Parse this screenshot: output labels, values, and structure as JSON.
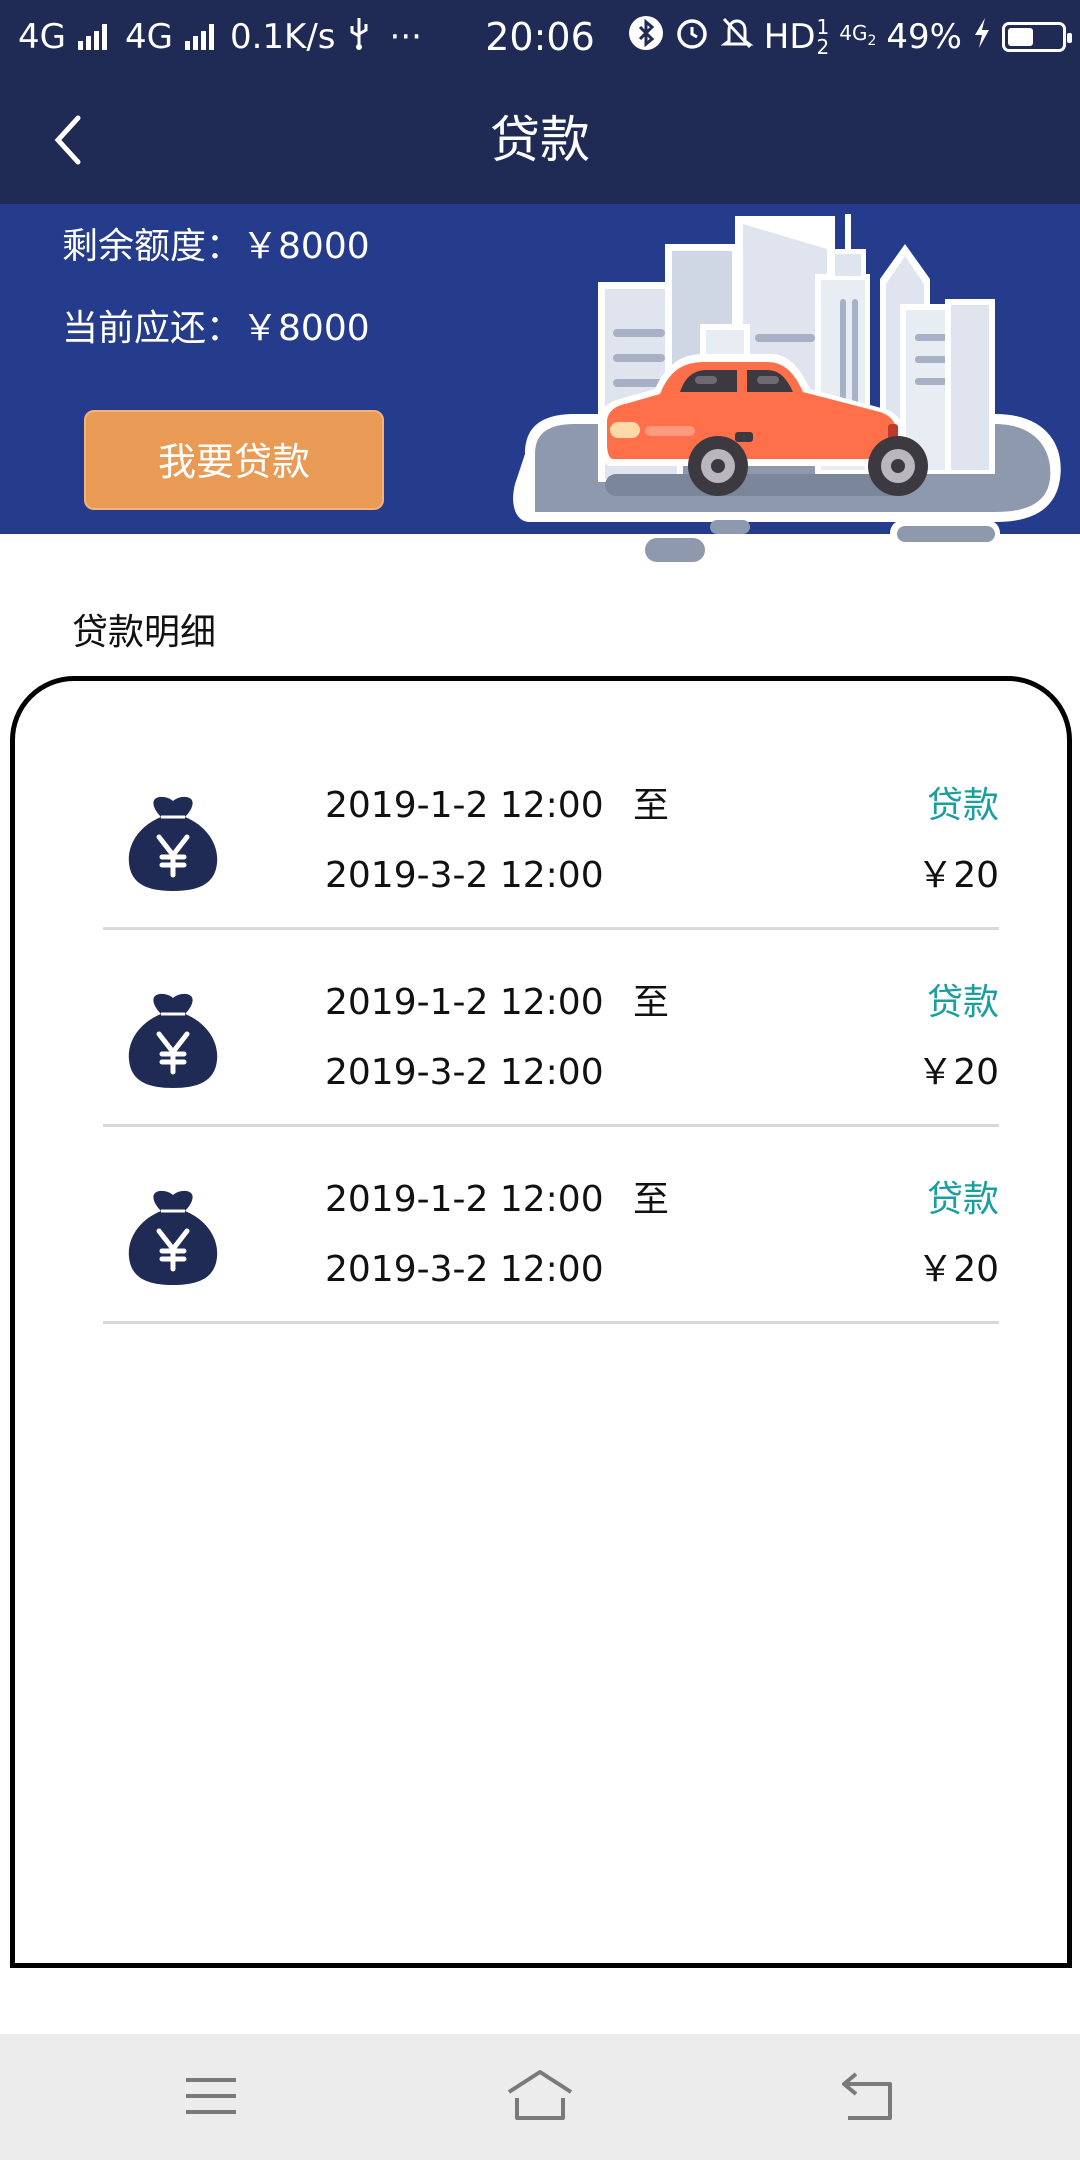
{
  "status_bar": {
    "network_1": "4G",
    "network_2": "4G",
    "speed": "0.1K/s",
    "usb_icon": "usb-icon",
    "more": "···",
    "time": "20:06",
    "hd": "HD",
    "hd_sup": "1",
    "hd_sub": "2",
    "net_small": "4G",
    "net_small_sub": "2",
    "battery": "49%",
    "battery_level": 0.49,
    "icons": [
      "bluetooth-icon",
      "alarm-icon",
      "mute-icon",
      "charging-icon",
      "battery-icon"
    ]
  },
  "nav": {
    "title": "贷款",
    "back_icon": "chevron-left-icon"
  },
  "hero": {
    "remaining_label": "剩余额度：",
    "remaining_value": "￥8000",
    "due_label": "当前应还：",
    "due_value": "￥8000",
    "loan_button": "我要贷款",
    "illustration": "city-car-illustration"
  },
  "details": {
    "title": "贷款明细",
    "rows": [
      {
        "start": "2019-1-2 12:00",
        "to": "至",
        "end": "2019-3-2 12:00",
        "type": "贷款",
        "amount": "￥20",
        "icon": "money-bag-icon"
      },
      {
        "start": "2019-1-2 12:00",
        "to": "至",
        "end": "2019-3-2 12:00",
        "type": "贷款",
        "amount": "￥20",
        "icon": "money-bag-icon"
      },
      {
        "start": "2019-1-2 12:00",
        "to": "至",
        "end": "2019-3-2 12:00",
        "type": "贷款",
        "amount": "￥20",
        "icon": "money-bag-icon"
      }
    ]
  },
  "bottom_nav": {
    "icons": [
      "menu-icon",
      "home-icon",
      "back-icon"
    ]
  },
  "colors": {
    "header_bg": "#1f2a55",
    "hero_bg": "#253b8c",
    "button_orange": "#e99a55",
    "teal": "#1a9e9e",
    "bag_navy": "#1f2a55"
  }
}
